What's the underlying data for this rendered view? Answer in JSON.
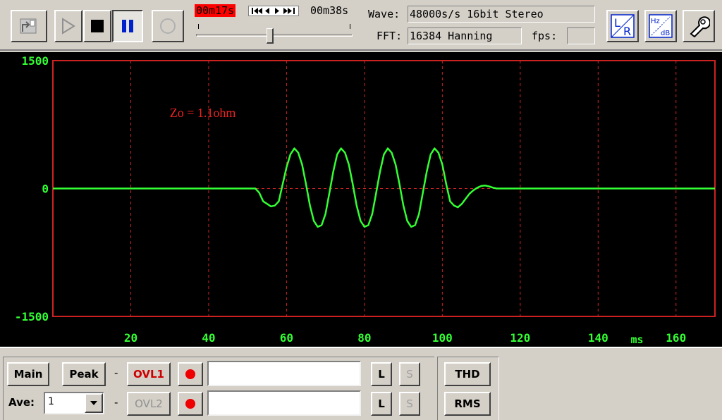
{
  "toolbar": {
    "elapsed_time": "00m17s",
    "total_time": "00m38s",
    "wave_label": "Wave:",
    "wave_value": "48000s/s 16bit Stereo",
    "fft_label": "FFT:",
    "fft_value": "16384 Hanning",
    "fps_label": "fps:",
    "fps_value": "",
    "position_fraction": 0.47,
    "icons": [
      "export-icon",
      "play-icon",
      "stop-icon",
      "pause-icon",
      "record-icon",
      "rewind-ff-icon",
      "lr-channel-icon",
      "hz-db-icon",
      "settings-wrench-icon"
    ],
    "hz_db_label_hz": "Hz",
    "hz_db_label_db": "dB",
    "lr_label_l": "L",
    "lr_label_r": "R"
  },
  "colors": {
    "background": "#000000",
    "frame": "#cc2222",
    "grid": "#cc2222",
    "trace": "#33ff33",
    "axis_text": "#33ff33",
    "annotation": "#ee2222",
    "elapsed_bg": "#ff0000"
  },
  "chart_data": {
    "type": "line",
    "title": "",
    "annotation": "Zo = 1.1ohm",
    "xlabel": "ms",
    "ylabel": "",
    "xlim": [
      0,
      170
    ],
    "ylim": [
      -1500,
      1500
    ],
    "x_ticks": [
      20,
      40,
      60,
      80,
      100,
      120,
      140,
      160
    ],
    "y_ticks": [
      1500,
      0,
      -1500
    ],
    "grid": true,
    "series": [
      {
        "values_x": [
          0,
          52,
          53,
          54,
          55,
          56,
          57,
          58,
          59,
          60,
          61,
          62,
          63,
          64,
          65,
          66,
          67,
          68,
          69,
          70,
          71,
          72,
          73,
          74,
          75,
          76,
          77,
          78,
          79,
          80,
          81,
          82,
          83,
          84,
          85,
          86,
          87,
          88,
          89,
          90,
          91,
          92,
          93,
          94,
          95,
          96,
          97,
          98,
          99,
          100,
          101,
          102,
          103,
          104,
          105,
          106,
          107,
          108,
          109,
          110,
          111,
          112,
          113,
          114,
          115,
          116,
          117,
          118,
          119,
          120,
          121,
          122,
          123,
          124,
          125,
          126,
          127,
          128,
          170
        ],
        "values_y": [
          0,
          0,
          -50,
          -150,
          -180,
          -210,
          -200,
          -150,
          50,
          250,
          400,
          470,
          420,
          280,
          50,
          -200,
          -380,
          -450,
          -430,
          -300,
          -50,
          200,
          400,
          470,
          420,
          280,
          50,
          -200,
          -380,
          -450,
          -430,
          -300,
          -50,
          200,
          400,
          470,
          420,
          280,
          50,
          -200,
          -380,
          -450,
          -430,
          -300,
          -50,
          200,
          400,
          470,
          420,
          280,
          50,
          -150,
          -200,
          -220,
          -180,
          -120,
          -60,
          -20,
          10,
          30,
          35,
          25,
          10,
          0,
          0,
          0,
          0,
          0,
          0,
          0,
          0,
          0,
          0,
          0,
          0,
          0,
          0,
          0,
          0
        ]
      }
    ]
  },
  "bottom_panel": {
    "main_label": "Main",
    "peak_label": "Peak",
    "ave_label": "Ave:",
    "ave_value": "1",
    "dash1": "-",
    "dash2": "-",
    "ovl1_label": "OVL1",
    "ovl2_label": "OVL2",
    "l_label": "L",
    "s_label": "S",
    "thd_label": "THD",
    "rms_label": "RMS"
  }
}
